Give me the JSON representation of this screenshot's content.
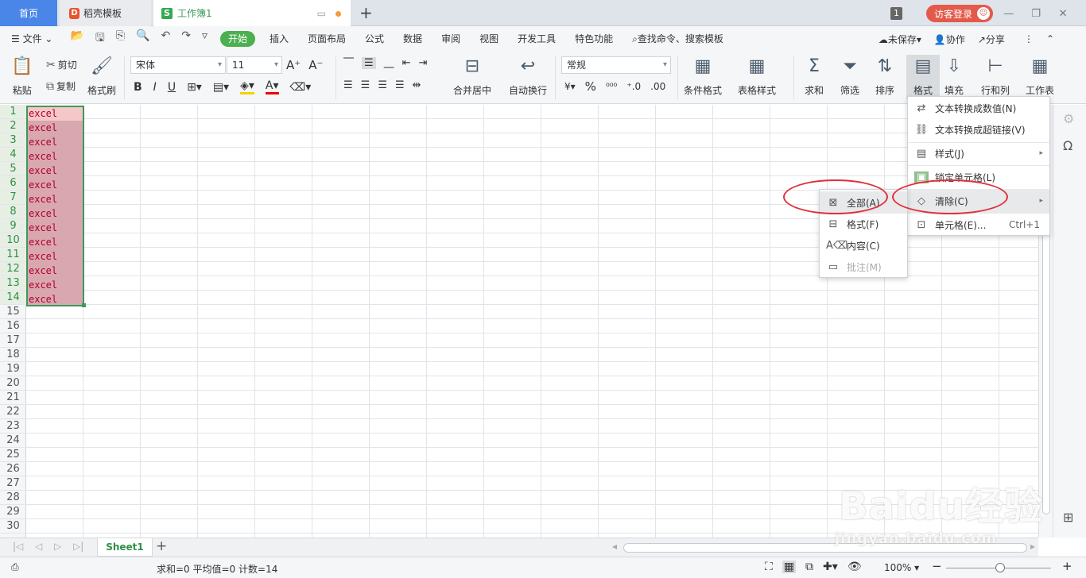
{
  "tabs": {
    "home": "首页",
    "template": "稻壳模板",
    "workbook": "工作簿1",
    "new_tab": "+"
  },
  "window": {
    "badge": "1",
    "login": "访客登录",
    "minimize": "—",
    "restore": "❐",
    "close": "✕"
  },
  "menu": {
    "file": "文件",
    "items": [
      "开始",
      "插入",
      "页面布局",
      "公式",
      "数据",
      "审阅",
      "视图",
      "开发工具",
      "特色功能"
    ],
    "search": "查找命令、搜索模板",
    "unsaved": "未保存",
    "collab": "协作",
    "share": "分享"
  },
  "ribbon": {
    "paste": "粘贴",
    "cut": "剪切",
    "copy": "复制",
    "format_painter": "格式刷",
    "font": "宋体",
    "size": "11",
    "merge": "合并居中",
    "wrap": "自动换行",
    "number_format": "常规",
    "cond_format": "条件格式",
    "table_style": "表格样式",
    "sum": "求和",
    "filter": "筛选",
    "sort": "排序",
    "format": "格式",
    "fill": "填充",
    "rowcol": "行和列",
    "sheet": "工作表"
  },
  "rows": [
    "1",
    "2",
    "3",
    "4",
    "5",
    "6",
    "7",
    "8",
    "9",
    "10",
    "11",
    "12",
    "13",
    "14",
    "15",
    "16",
    "17",
    "18",
    "19",
    "20",
    "21",
    "22",
    "23",
    "24",
    "25",
    "26",
    "27",
    "28",
    "29",
    "30"
  ],
  "cells": [
    "excel",
    "excel",
    "excel",
    "excel",
    "excel",
    "excel",
    "excel",
    "excel",
    "excel",
    "excel",
    "excel",
    "excel",
    "excel",
    "excel"
  ],
  "format_menu": {
    "items": [
      {
        "label": "文本转换成数值(N)"
      },
      {
        "label": "文本转换成超链接(V)"
      },
      {
        "label": "样式(J)"
      },
      {
        "label": "锁定单元格(L)"
      },
      {
        "label": "清除(C)"
      },
      {
        "label": "单元格(E)...",
        "shortcut": "Ctrl+1"
      }
    ]
  },
  "clear_submenu": {
    "items": [
      {
        "label": "全部(A)"
      },
      {
        "label": "格式(F)"
      },
      {
        "label": "内容(C)"
      },
      {
        "label": "批注(M)"
      }
    ]
  },
  "sheet": {
    "name": "Sheet1"
  },
  "status": {
    "text": "求和=0  平均值=0  计数=14",
    "zoom": "100%"
  },
  "watermark": {
    "brand": "Baidu经验",
    "url": "jingyan.baidu.com"
  }
}
